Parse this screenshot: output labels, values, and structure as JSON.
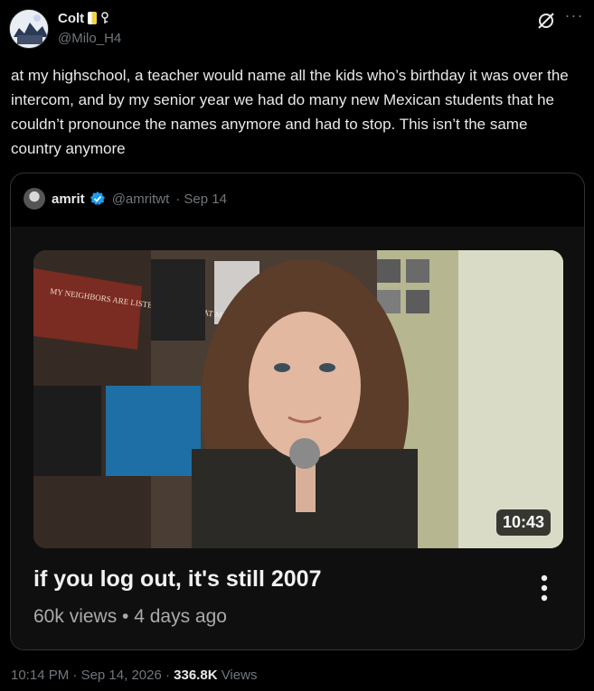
{
  "author": {
    "name": "Colt",
    "handle": "@Milo_H4"
  },
  "tweet": {
    "text": "at my highschool, a teacher would name all the kids who’s birthday it was over the intercom, and by my senior year we had do many new Mexican students that he couldn’t pronounce the names anymore and had to stop. This isn’t the same country anymore"
  },
  "quote": {
    "name": "amrit",
    "handle": "@amritwt",
    "date": "· Sep 14",
    "video": {
      "duration": "10:43",
      "title": "if you log out, it's still 2007",
      "meta": "60k views • 4 days ago",
      "poster_text": "MY NEIGHBORS ARE LISTENING TO GREAT MUSIC"
    }
  },
  "footer": {
    "time": "10:14 PM",
    "date": "Sep 14, 2026",
    "views_count": "336.8K",
    "views_label": "Views"
  },
  "colors": {
    "background": "#000000",
    "text": "#e7e9ea",
    "muted": "#71767b",
    "verified": "#1d9bf0",
    "badge_yellow": "#f3d24a"
  }
}
